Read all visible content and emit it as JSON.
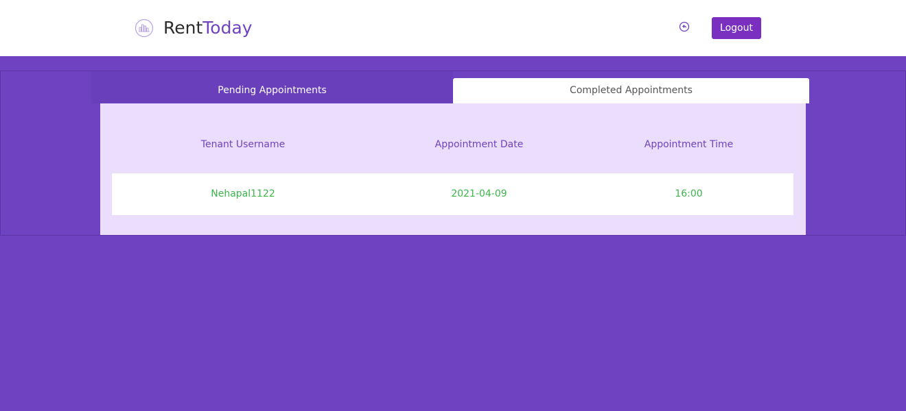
{
  "header": {
    "brand_part1": "Rent",
    "brand_part2": "Today",
    "logo_icon": "city-skyline-icon",
    "nav_icon": "back-arrow-icon",
    "logout_label": "Logout"
  },
  "tabs": [
    {
      "label": "Pending Appointments",
      "active": false
    },
    {
      "label": "Completed Appointments",
      "active": true
    }
  ],
  "table": {
    "headers": [
      "Tenant Username",
      "Appointment Date",
      "Appointment Time"
    ],
    "rows": [
      [
        "Nehapal1122",
        "2021-04-09",
        "16:00"
      ]
    ]
  },
  "colors": {
    "primary": "#6f42c1",
    "button": "#7b2fc0",
    "panel": "#ebdefd",
    "accent_green": "#3cb54a"
  }
}
